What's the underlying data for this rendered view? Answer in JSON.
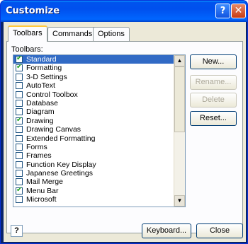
{
  "window": {
    "title": "Customize"
  },
  "title_buttons": {
    "help": "?",
    "close": "✕"
  },
  "tabs": [
    {
      "label": "Toolbars",
      "active": true
    },
    {
      "label": "Commands",
      "active": false
    },
    {
      "label": "Options",
      "active": false
    }
  ],
  "toolbars": {
    "label": "Toolbars:",
    "items": [
      {
        "label": "Standard",
        "checked": true,
        "selected": true
      },
      {
        "label": "Formatting",
        "checked": true,
        "selected": false
      },
      {
        "label": "3-D Settings",
        "checked": false,
        "selected": false
      },
      {
        "label": "AutoText",
        "checked": false,
        "selected": false
      },
      {
        "label": "Control Toolbox",
        "checked": false,
        "selected": false
      },
      {
        "label": "Database",
        "checked": false,
        "selected": false
      },
      {
        "label": "Diagram",
        "checked": false,
        "selected": false
      },
      {
        "label": "Drawing",
        "checked": true,
        "selected": false
      },
      {
        "label": "Drawing Canvas",
        "checked": false,
        "selected": false
      },
      {
        "label": "Extended Formatting",
        "checked": false,
        "selected": false
      },
      {
        "label": "Forms",
        "checked": false,
        "selected": false
      },
      {
        "label": "Frames",
        "checked": false,
        "selected": false
      },
      {
        "label": "Function Key Display",
        "checked": false,
        "selected": false
      },
      {
        "label": "Japanese Greetings",
        "checked": false,
        "selected": false
      },
      {
        "label": "Mail Merge",
        "checked": false,
        "selected": false
      },
      {
        "label": "Menu Bar",
        "checked": true,
        "selected": false
      },
      {
        "label": "Microsoft",
        "checked": false,
        "selected": false
      }
    ]
  },
  "buttons": {
    "new": "New...",
    "rename": "Rename...",
    "delete": "Delete",
    "reset": "Reset...",
    "keyboard": "Keyboard...",
    "close": "Close"
  }
}
